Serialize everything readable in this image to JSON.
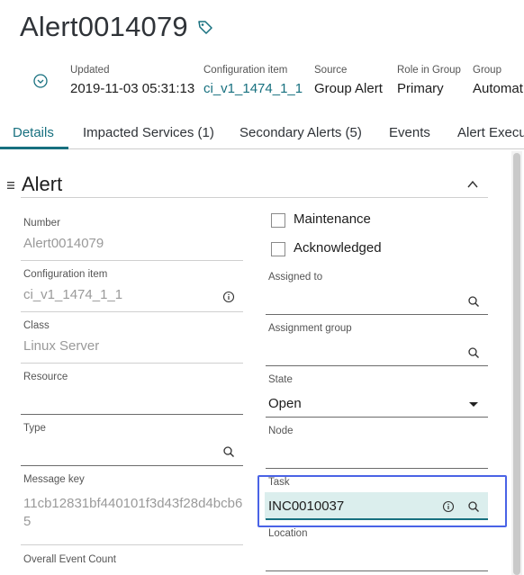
{
  "record": {
    "title": "Alert0014079"
  },
  "meta": [
    {
      "key": "Updated",
      "value": "2019-11-03 05:31:13"
    },
    {
      "key": "Configuration item",
      "value": "ci_v1_1474_1_1"
    },
    {
      "key": "Source",
      "value": "Group Alert"
    },
    {
      "key": "Role in Group",
      "value": "Primary"
    },
    {
      "key": "Group",
      "value": "Automat"
    }
  ],
  "tabs": [
    {
      "label": "Details"
    },
    {
      "label": "Impacted Services (1)"
    },
    {
      "label": "Secondary Alerts (5)"
    },
    {
      "label": "Events"
    },
    {
      "label": "Alert Execu"
    }
  ],
  "section": {
    "title": "Alert"
  },
  "left_fields": {
    "number": {
      "label": "Number",
      "value": "Alert0014079"
    },
    "config_item": {
      "label": "Configuration item",
      "value": "ci_v1_1474_1_1"
    },
    "class": {
      "label": "Class",
      "value": "Linux Server"
    },
    "resource": {
      "label": "Resource",
      "value": ""
    },
    "type": {
      "label": "Type",
      "value": ""
    },
    "message_key": {
      "label": "Message key",
      "value_line1": "11cb12831bf440101f3d43f28d4bcb6",
      "value_line2": "5"
    },
    "overall_event_count": {
      "label": "Overall Event Count"
    }
  },
  "right_fields": {
    "maintenance": {
      "label": "Maintenance"
    },
    "acknowledged": {
      "label": "Acknowledged"
    },
    "assigned_to": {
      "label": "Assigned to",
      "value": ""
    },
    "assignment_group": {
      "label": "Assignment group",
      "value": ""
    },
    "state": {
      "label": "State",
      "value": "Open"
    },
    "node": {
      "label": "Node",
      "value": ""
    },
    "task": {
      "label": "Task",
      "value": "INC0010037"
    },
    "location": {
      "label": "Location",
      "value": ""
    }
  },
  "colors": {
    "accent": "#17707f",
    "highlight_border": "#4a63e6",
    "task_fill": "#dbeeed"
  }
}
